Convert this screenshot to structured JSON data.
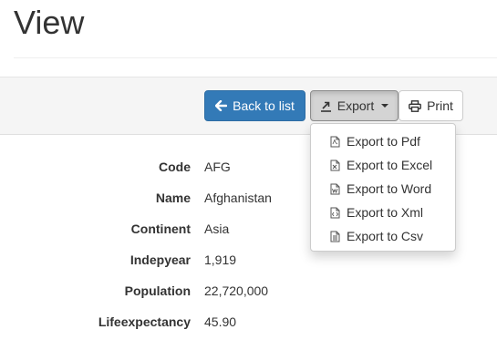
{
  "page": {
    "title": "View"
  },
  "toolbar": {
    "back_label": "Back to list",
    "export_label": "Export",
    "print_label": "Print"
  },
  "export_menu": {
    "items": [
      {
        "label": "Export to Pdf",
        "icon": "file-pdf-icon"
      },
      {
        "label": "Export to Excel",
        "icon": "file-excel-icon"
      },
      {
        "label": "Export to Word",
        "icon": "file-word-icon"
      },
      {
        "label": "Export to Xml",
        "icon": "file-xml-icon"
      },
      {
        "label": "Export to Csv",
        "icon": "file-csv-icon"
      }
    ]
  },
  "record": {
    "fields": [
      {
        "label": "Code",
        "value": "AFG"
      },
      {
        "label": "Name",
        "value": "Afghanistan"
      },
      {
        "label": "Continent",
        "value": "Asia"
      },
      {
        "label": "Indepyear",
        "value": "1,919"
      },
      {
        "label": "Population",
        "value": "22,720,000"
      },
      {
        "label": "Lifeexpectancy",
        "value": "45.90"
      }
    ]
  },
  "colors": {
    "primary": "#337ab7",
    "toolbar_bg": "#f5f5f5",
    "text": "#333333"
  }
}
